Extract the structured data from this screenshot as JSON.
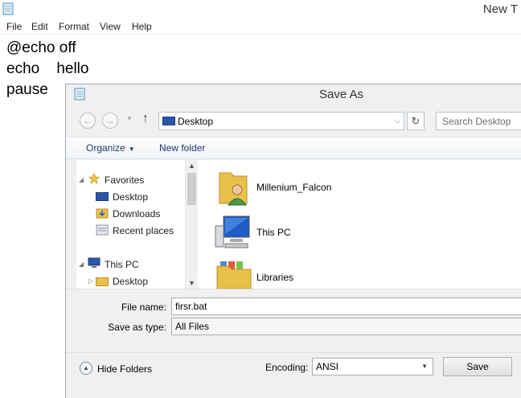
{
  "notepad": {
    "title": "New T",
    "menu": [
      "File",
      "Edit",
      "Format",
      "View",
      "Help"
    ],
    "lines": [
      "@echo off",
      "echo    hello",
      "pause"
    ]
  },
  "dialog": {
    "title": "Save As",
    "address": "Desktop",
    "search_placeholder": "Search Desktop",
    "commands": {
      "organize": "Organize",
      "new_folder": "New folder"
    },
    "nav": {
      "favorites": "Favorites",
      "favorites_items": [
        "Desktop",
        "Downloads",
        "Recent places"
      ],
      "this_pc": "This PC",
      "this_pc_items": [
        "Desktop"
      ]
    },
    "files": [
      "Millenium_Falcon",
      "This PC",
      "Libraries"
    ],
    "file_name_label": "File name:",
    "file_name_value": "firsr.bat",
    "save_as_type_label": "Save as type:",
    "save_as_type_value": "All Files",
    "hide_folders": "Hide Folders",
    "encoding_label": "Encoding:",
    "encoding_value": "ANSI",
    "save_button": "Save"
  },
  "colors": {
    "accent": "#1e3a6e",
    "dialog_bg": "#f0f0f0",
    "folder": "#e8c04a"
  }
}
